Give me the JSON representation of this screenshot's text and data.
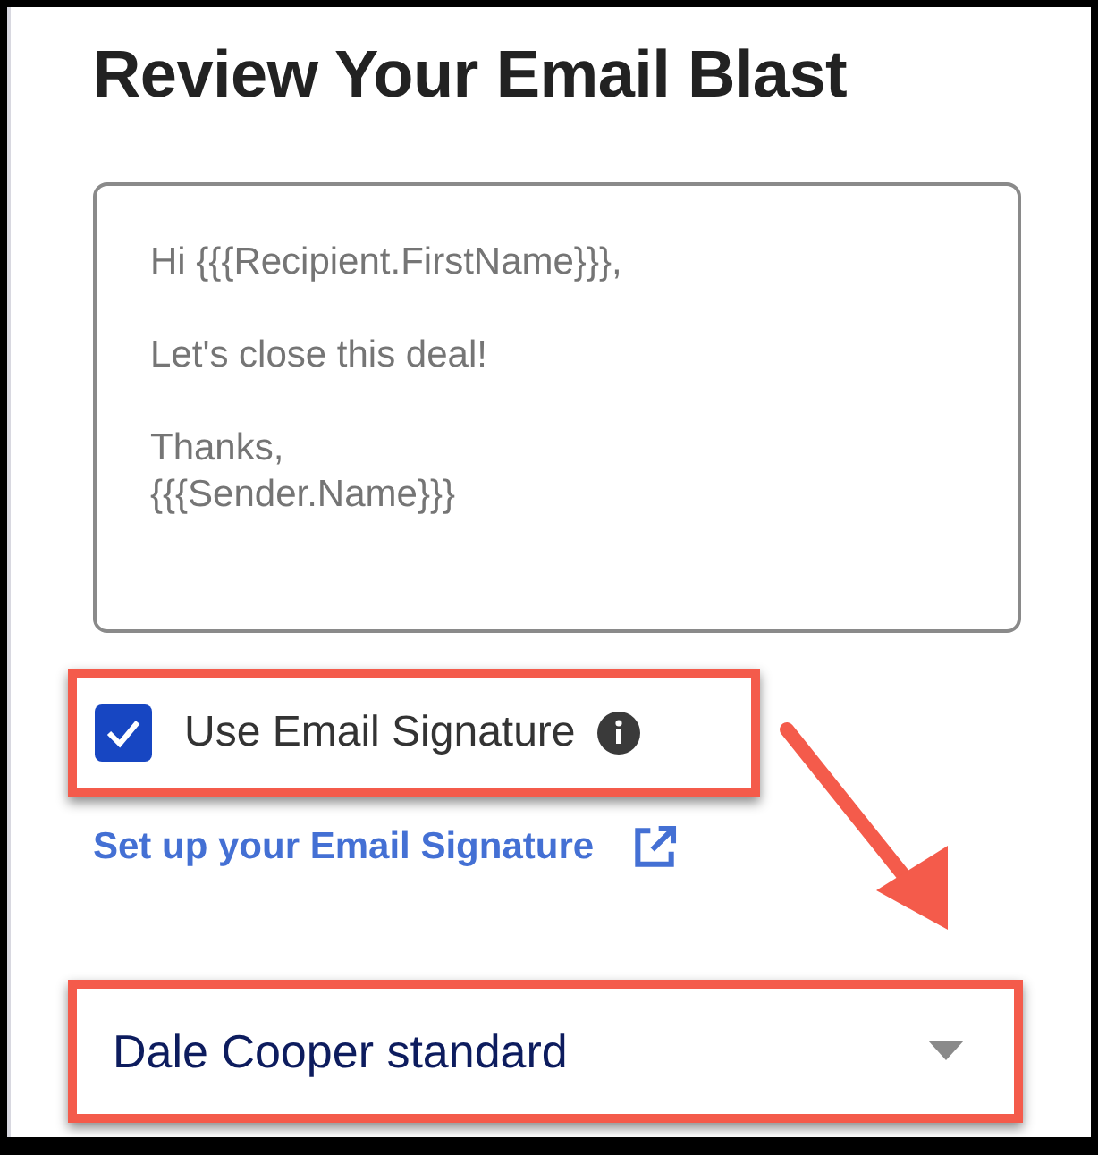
{
  "title": "Review Your Email Blast",
  "message": {
    "paragraphs": [
      [
        "Hi {{{Recipient.FirstName}}},"
      ],
      [
        "Let's close this deal!"
      ],
      [
        "Thanks,",
        "{{{Sender.Name}}}"
      ]
    ]
  },
  "signature": {
    "label": "Use Email Signature",
    "checked": true
  },
  "setup_link": "Set up your Email Signature",
  "signature_select": {
    "value": "Dale Cooper standard"
  }
}
